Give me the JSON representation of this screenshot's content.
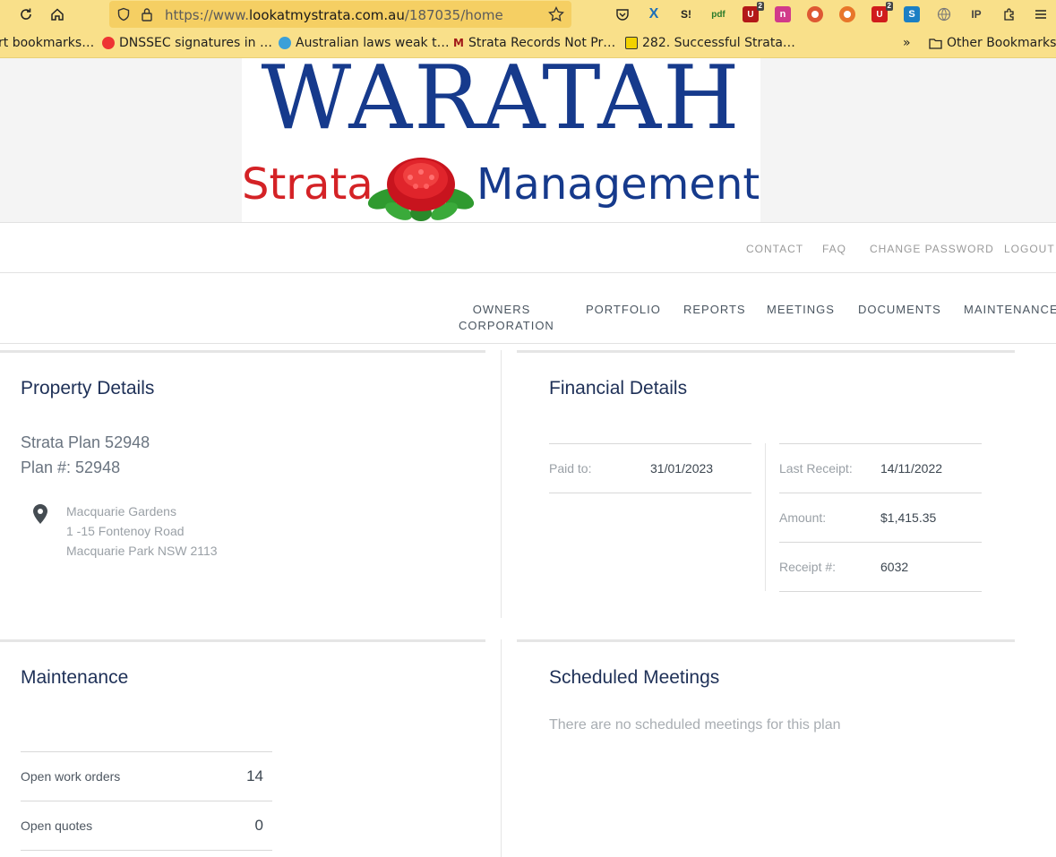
{
  "browser": {
    "url_prefix": "https://www.",
    "url_host": "lookatmystrata.com.au",
    "url_path": "/187035/home",
    "extensions": [
      {
        "icon": "pocket-icon",
        "badge": ""
      },
      {
        "icon": "x-icon",
        "letter": "X",
        "color": "#1d6fb8",
        "badge": ""
      },
      {
        "icon": "s-icon",
        "letter": "S!",
        "color": "#222",
        "badge": ""
      },
      {
        "icon": "pdf-icon",
        "badge": ""
      },
      {
        "icon": "ublock-icon",
        "badge": "2"
      },
      {
        "icon": "n-icon",
        "letter": "n",
        "badge": ""
      },
      {
        "icon": "duckduckgo-icon",
        "badge": ""
      },
      {
        "icon": "ball-icon",
        "badge": ""
      },
      {
        "icon": "shield-ext-icon",
        "badge": "2"
      },
      {
        "icon": "s-blue-icon",
        "letter": "S",
        "badge": ""
      },
      {
        "icon": "globe-icon",
        "badge": ""
      },
      {
        "icon": "ip-icon",
        "letter": "IP",
        "badge": ""
      }
    ]
  },
  "bookmarks": [
    {
      "label": "rt bookmarks…"
    },
    {
      "label": "DNSSEC signatures in …"
    },
    {
      "label": "Australian laws weak t…"
    },
    {
      "label": "Strata Records Not Pr…"
    },
    {
      "label": "282. Successful Strata…"
    }
  ],
  "bookmarks_other": "Other Bookmarks",
  "logo": {
    "title": "WARATAH",
    "left": "Strata",
    "right": "Management"
  },
  "util_nav": [
    "CONTACT",
    "FAQ",
    "CHANGE PASSWORD",
    "LOGOUT"
  ],
  "main_nav": {
    "owners_line1": "OWNERS",
    "owners_line2": "CORPORATION",
    "portfolio": "PORTFOLIO",
    "reports": "REPORTS",
    "meetings": "MEETINGS",
    "documents": "DOCUMENTS",
    "maintenance": "MAINTENANCE"
  },
  "property": {
    "heading": "Property Details",
    "plan_name": "Strata Plan 52948",
    "plan_number": "Plan #: 52948",
    "address": [
      "Macquarie Gardens",
      "1 -15 Fontenoy Road",
      "Macquarie Park NSW 2113"
    ]
  },
  "financial": {
    "heading": "Financial Details",
    "paid_to_label": "Paid to:",
    "paid_to_value": "31/01/2023",
    "last_receipt_label": "Last Receipt:",
    "last_receipt_value": "14/11/2022",
    "amount_label": "Amount:",
    "amount_value": "$1,415.35",
    "receipt_no_label": "Receipt #:",
    "receipt_no_value": "6032"
  },
  "maintenance": {
    "heading": "Maintenance",
    "work_orders_label": "Open work orders",
    "work_orders_value": "14",
    "quotes_label": "Open quotes",
    "quotes_value": "0"
  },
  "meetings": {
    "heading": "Scheduled Meetings",
    "empty": "There are no scheduled meetings for this plan"
  },
  "colors": {
    "brand_blue": "#163a8c",
    "brand_red": "#d42226",
    "toolbar": "#f9e08a",
    "heading": "#1e3057"
  }
}
